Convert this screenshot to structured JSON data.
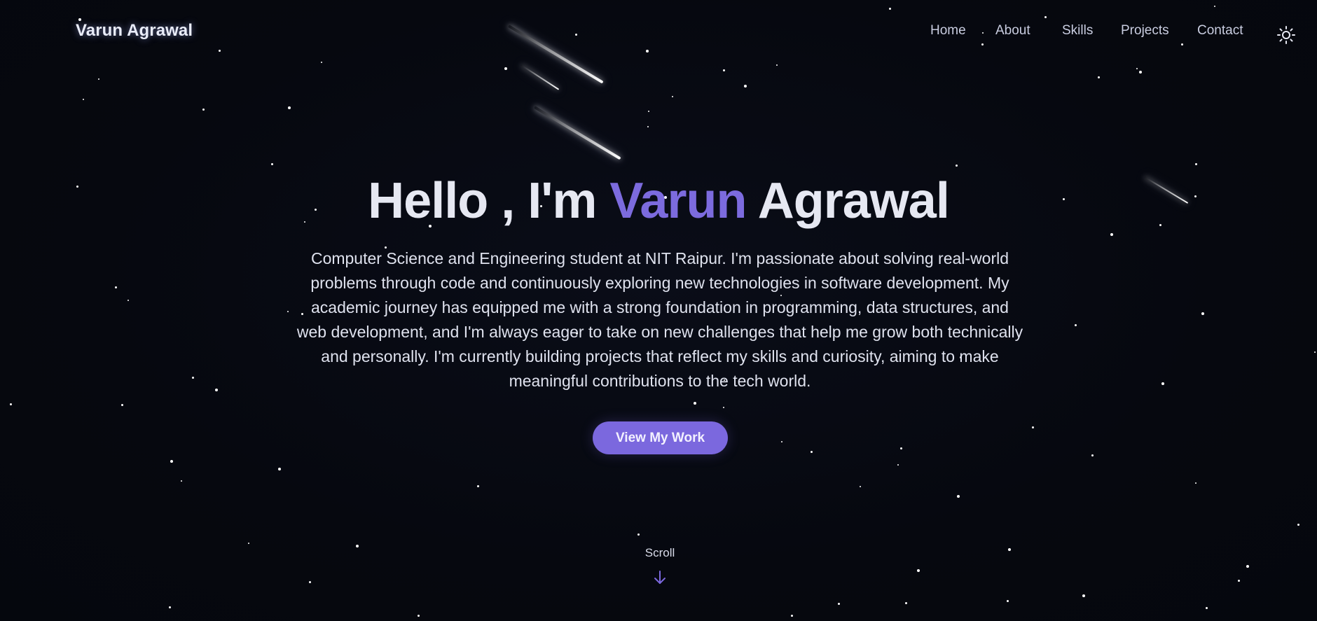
{
  "header": {
    "logo": "Varun Agrawal",
    "nav": [
      "Home",
      "About",
      "Skills",
      "Projects",
      "Contact"
    ],
    "theme_icon": "sun-icon"
  },
  "hero": {
    "title_prefix": "Hello , I'm ",
    "title_accent": "Varun",
    "title_suffix": " Agrawal",
    "description": "Computer Science and Engineering student at NIT Raipur. I'm passionate about solving real-world problems through code and continuously exploring new technologies in software development. My academic journey has equipped me with a strong foundation in programming, data structures, and web development, and I'm always eager to take on new challenges that help me grow both technically and personally. I'm currently building projects that reflect my skills and curiosity, aiming to make meaningful contributions to the tech world.",
    "cta_label": "View My Work"
  },
  "scroll": {
    "label": "Scroll",
    "icon": "arrow-down-icon"
  },
  "colors": {
    "background": "#060810",
    "accent": "#7b68de",
    "text": "#e6e8f2"
  }
}
